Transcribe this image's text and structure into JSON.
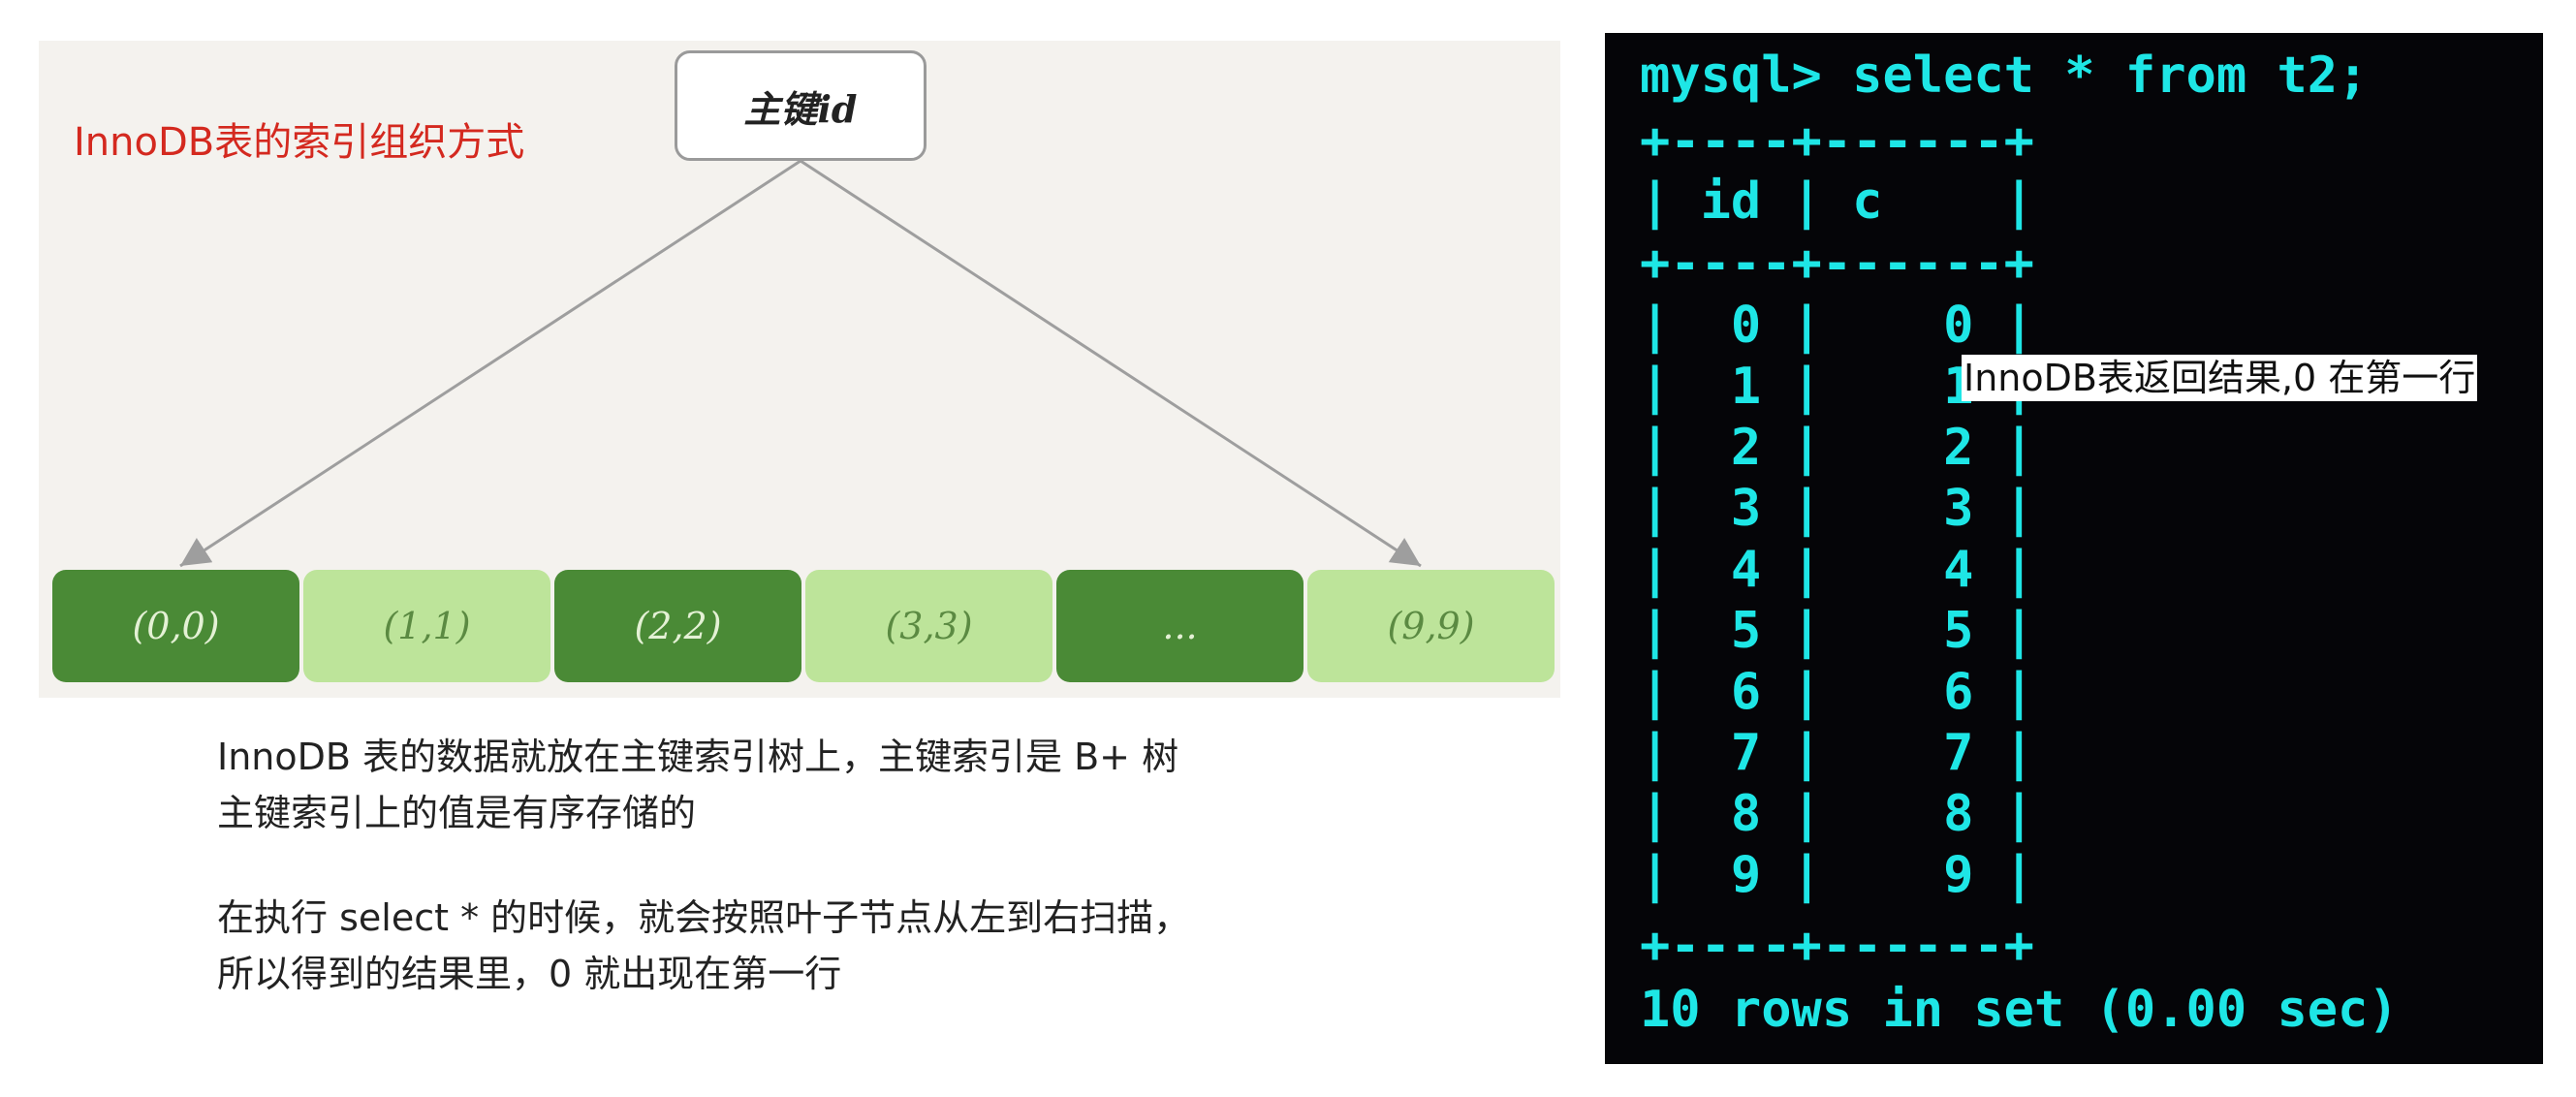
{
  "diagram": {
    "title": "InnoDB表的索引组织方式",
    "root_label": "主键id",
    "leaves": [
      {
        "label": "(0,0)",
        "shade": "dark"
      },
      {
        "label": "(1,1)",
        "shade": "light"
      },
      {
        "label": "(2,2)",
        "shade": "dark"
      },
      {
        "label": "(3,3)",
        "shade": "light"
      },
      {
        "label": "...",
        "shade": "dark"
      },
      {
        "label": "(9,9)",
        "shade": "light"
      }
    ],
    "colors": {
      "title": "#d4291f",
      "leaf_dark": "#4a8a36",
      "leaf_light": "#bde49a",
      "edge": "#9e9e9e"
    }
  },
  "captions": [
    "InnoDB 表的数据就放在主键索引树上，主键索引是 B+ 树",
    "主键索引上的值是有序存储的",
    "在执行 select * 的时候，就会按照叶子节点从左到右扫描，",
    "所以得到的结果里，0 就出现在第一行"
  ],
  "terminal": {
    "prompt": "mysql> select * from t2;",
    "border": "+----+------+",
    "header": "| id | c    |",
    "rows": [
      "|  0 |    0 |",
      "|  1 |    1 |",
      "|  2 |    2 |",
      "|  3 |    3 |",
      "|  4 |    4 |",
      "|  5 |    5 |",
      "|  6 |    6 |",
      "|  7 |    7 |",
      "|  8 |    8 |",
      "|  9 |    9 |"
    ],
    "footer": "10 rows in set (0.00 sec)",
    "text_color": "#1ee6e6"
  },
  "overlay_label": "InnoDB表返回结果,0 在第一行"
}
